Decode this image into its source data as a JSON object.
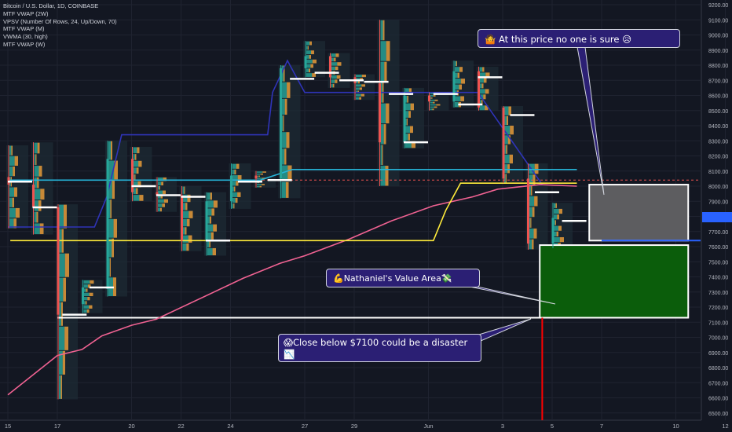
{
  "legend": {
    "symbol": "Bitcoin / U.S. Dollar, 1D, COINBASE",
    "indicators": [
      "MTF VWAP (2W)",
      "VPSV (Number Of Rows, 24, Up/Down, 70)",
      "MTF VWAP (M)",
      "VWMA (30, high)",
      "MTF VWAP (W)"
    ]
  },
  "annotations": {
    "top": {
      "icon": "person-shrugging-icon",
      "text": "At this price no one is sure",
      "emoji": "worried-face-icon"
    },
    "value_area": {
      "icon": "flexed-biceps-icon",
      "text": "Nathaniel's Value Area",
      "emoji": "money-icon"
    },
    "disaster": {
      "icon": "scared-face-icon",
      "text": "Close below $7100 could be a disaster",
      "emoji": "chart-down-icon"
    }
  },
  "colors": {
    "background": "#131722",
    "up": "#26a69a",
    "down": "#ef5350",
    "vwap_2w": "#2f34b8",
    "vwap_m": "#26b5d9",
    "vwma": "#f06292",
    "vwap_w": "#ffeb3b",
    "value_area": "#0b5d0b",
    "grey_box": "#5d5d60",
    "callout_bg": "#2b1f74",
    "price_label": "#2962ff",
    "red_line": "#ff0000"
  },
  "chart_data": {
    "type": "line",
    "title": "Bitcoin / U.S. Dollar, 1D, COINBASE",
    "xlabel": "",
    "ylabel": "",
    "x_ticks": [
      "15",
      "17",
      "20",
      "22",
      "24",
      "27",
      "29",
      "Jun",
      "3",
      "5",
      "7",
      "10",
      "12"
    ],
    "y_ticks": [
      9200,
      9100,
      9000,
      8900,
      8800,
      8700,
      8600,
      8500,
      8400,
      8300,
      8200,
      8100,
      8000,
      7900,
      7800,
      7700,
      7600,
      7500,
      7400,
      7300,
      7200,
      7100,
      7000,
      6900,
      6800,
      6700,
      6600,
      6500
    ],
    "ylim": [
      6450,
      9250
    ],
    "grid": true,
    "current_price_label": "",
    "series": [
      {
        "name": "MTF VWAP (2W)",
        "values": [
          [
            15,
            7730
          ],
          [
            17.3,
            7730
          ],
          [
            18.5,
            7730
          ],
          [
            19,
            7930
          ],
          [
            19.6,
            8340
          ],
          [
            25.5,
            8340
          ],
          [
            25.7,
            8620
          ],
          [
            26.3,
            8830
          ],
          [
            27,
            8620
          ],
          [
            34,
            8620
          ],
          [
            36.6,
            8010
          ]
        ]
      },
      {
        "name": "MTF VWAP (M)",
        "values": [
          [
            15,
            8040
          ],
          [
            25.2,
            8040
          ],
          [
            26.5,
            8110
          ],
          [
            38,
            8110
          ]
        ]
      },
      {
        "name": "VWMA (30, high)",
        "values": [
          [
            15,
            6620
          ],
          [
            17,
            6880
          ],
          [
            18,
            6920
          ],
          [
            18.8,
            7010
          ],
          [
            20,
            7080
          ],
          [
            21,
            7120
          ],
          [
            24.5,
            7390
          ],
          [
            26,
            7490
          ],
          [
            27,
            7540
          ],
          [
            28.8,
            7650
          ],
          [
            30.5,
            7770
          ],
          [
            32.2,
            7870
          ],
          [
            33.8,
            7930
          ],
          [
            34.8,
            7980
          ],
          [
            36.5,
            8010
          ],
          [
            38,
            8000
          ]
        ]
      },
      {
        "name": "MTF VWAP (W)",
        "values": [
          [
            15.1,
            7640
          ],
          [
            32.2,
            7640
          ],
          [
            32.7,
            7840
          ],
          [
            33.3,
            8020
          ],
          [
            38,
            8020
          ]
        ]
      }
    ],
    "levels": [
      {
        "y": 8040,
        "style": "dashed",
        "color": "#ef5350",
        "from": 15,
        "to": 43
      },
      {
        "y": 7640,
        "style": "solid",
        "color": "#2962ff",
        "from": 39,
        "to": 43
      },
      {
        "y": 7130,
        "style": "solid",
        "color": "#ffffff",
        "from": 17,
        "to": 42.5
      }
    ],
    "zones": [
      {
        "name": "grey_box",
        "x": [
          38.5,
          42.5
        ],
        "y": [
          7640,
          8010
        ],
        "color": "#5d5d60"
      },
      {
        "name": "value_area",
        "x": [
          36.5,
          42.5
        ],
        "y": [
          7130,
          7610
        ],
        "color": "#0b5d0b"
      }
    ],
    "candles": [
      {
        "d": 15,
        "o": 8060,
        "h": 8270,
        "l": 7720,
        "c": 8010
      },
      {
        "d": 16,
        "o": 8010,
        "h": 8290,
        "l": 7680,
        "c": 7860
      },
      {
        "d": 17,
        "o": 7860,
        "h": 7880,
        "l": 6590,
        "c": 7150
      },
      {
        "d": 18,
        "o": 7220,
        "h": 7380,
        "l": 7160,
        "c": 7330
      },
      {
        "d": 19,
        "o": 7320,
        "h": 8300,
        "l": 7270,
        "c": 8180
      },
      {
        "d": 20,
        "o": 8180,
        "h": 8260,
        "l": 7900,
        "c": 7960
      },
      {
        "d": 21,
        "o": 7960,
        "h": 8060,
        "l": 7830,
        "c": 7940
      },
      {
        "d": 22,
        "o": 7940,
        "h": 8000,
        "l": 7570,
        "c": 7640
      },
      {
        "d": 23,
        "o": 7640,
        "h": 7960,
        "l": 7540,
        "c": 7900
      },
      {
        "d": 24,
        "o": 7900,
        "h": 8150,
        "l": 7850,
        "c": 8070
      },
      {
        "d": 25,
        "o": 8070,
        "h": 8100,
        "l": 7990,
        "c": 8050
      },
      {
        "d": 26,
        "o": 8050,
        "h": 8800,
        "l": 7920,
        "c": 8780
      },
      {
        "d": 27,
        "o": 8780,
        "h": 8960,
        "l": 8720,
        "c": 8860
      },
      {
        "d": 28,
        "o": 8860,
        "h": 8880,
        "l": 8650,
        "c": 8720
      },
      {
        "d": 29,
        "o": 8720,
        "h": 8740,
        "l": 8570,
        "c": 8680
      },
      {
        "d": 30,
        "o": 8680,
        "h": 9100,
        "l": 8000,
        "c": 8290
      },
      {
        "d": 31,
        "o": 8290,
        "h": 8650,
        "l": 8250,
        "c": 8600
      },
      {
        "d": 32,
        "o": 8600,
        "h": 8620,
        "l": 8500,
        "c": 8560
      },
      {
        "d": 33,
        "o": 8560,
        "h": 8830,
        "l": 8520,
        "c": 8760
      },
      {
        "d": 34,
        "o": 8760,
        "h": 8790,
        "l": 8500,
        "c": 8520
      },
      {
        "d": 35,
        "o": 8520,
        "h": 8530,
        "l": 8020,
        "c": 8050
      },
      {
        "d": 36,
        "o": 8050,
        "h": 8150,
        "l": 7580,
        "c": 7620
      },
      {
        "d": 37,
        "o": 7620,
        "h": 7890,
        "l": 7590,
        "c": 7790
      }
    ],
    "vwap_marks": [
      {
        "d": 15,
        "y": 8030
      },
      {
        "d": 16,
        "y": 7860
      },
      {
        "d": 17.2,
        "y": 7150
      },
      {
        "d": 18.3,
        "y": 7330
      },
      {
        "d": 20,
        "y": 8000
      },
      {
        "d": 21,
        "y": 7940
      },
      {
        "d": 22,
        "y": 7930
      },
      {
        "d": 23,
        "y": 7640
      },
      {
        "d": 24.3,
        "y": 8030
      },
      {
        "d": 25.5,
        "y": 8040
      },
      {
        "d": 26.4,
        "y": 8710
      },
      {
        "d": 27.4,
        "y": 8750
      },
      {
        "d": 28.4,
        "y": 8700
      },
      {
        "d": 29.4,
        "y": 8690
      },
      {
        "d": 30.4,
        "y": 8610
      },
      {
        "d": 31,
        "y": 8290
      },
      {
        "d": 32.2,
        "y": 8610
      },
      {
        "d": 33.2,
        "y": 8540
      },
      {
        "d": 34,
        "y": 8720
      },
      {
        "d": 35.3,
        "y": 8470
      },
      {
        "d": 36.3,
        "y": 7960
      },
      {
        "d": 37.4,
        "y": 7770
      }
    ]
  }
}
